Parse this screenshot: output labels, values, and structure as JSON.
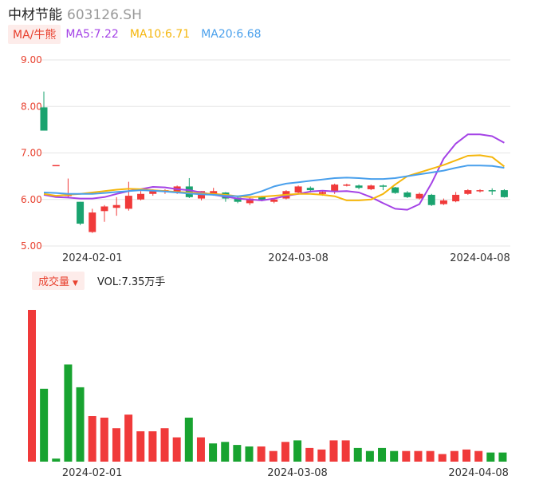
{
  "header": {
    "name": "中材节能",
    "code": "603126.SH"
  },
  "ma_bar": {
    "toggle_label": "MA/牛熊",
    "ma5": "MA5:7.22",
    "ma10": "MA10:6.71",
    "ma20": "MA20:6.68"
  },
  "volume_bar": {
    "toggle_label": "成交量",
    "vol_text": "VOL:7.35万手"
  },
  "colors": {
    "up": "#f03a3a",
    "down": "#1aa36f",
    "vol_down": "#18a330",
    "ma5": "#a442e6",
    "ma10": "#f5b60c",
    "ma20": "#4aa0ec",
    "grid": "#e6e6e6",
    "axis_text": "#e8412f"
  },
  "chart_data": [
    {
      "type": "candlestick",
      "title": "",
      "y_ticks": [
        "9.00",
        "8.00",
        "7.00",
        "6.00",
        "5.00"
      ],
      "ylim": [
        5.0,
        9.0
      ],
      "x_tick_labels": [
        "2024-02-01",
        "2024-03-08",
        "2024-04-08"
      ],
      "x_tick_indices": [
        4,
        21,
        36
      ],
      "grid": true,
      "candles": [
        {
          "o": 7.98,
          "c": 7.48,
          "h": 8.32,
          "l": 7.75
        },
        {
          "o": 6.74,
          "c": 6.74,
          "h": 6.74,
          "l": 6.74
        },
        {
          "o": 6.1,
          "c": 6.1,
          "h": 6.45,
          "l": 6.05
        },
        {
          "o": 5.95,
          "c": 5.48,
          "h": 5.95,
          "l": 5.45
        },
        {
          "o": 5.3,
          "c": 5.72,
          "h": 5.8,
          "l": 5.28
        },
        {
          "o": 5.75,
          "c": 5.85,
          "h": 5.88,
          "l": 5.52
        },
        {
          "o": 5.82,
          "c": 5.88,
          "h": 6.05,
          "l": 5.65
        },
        {
          "o": 5.8,
          "c": 6.08,
          "h": 6.38,
          "l": 5.76
        },
        {
          "o": 6.0,
          "c": 6.12,
          "h": 6.18,
          "l": 5.98
        },
        {
          "o": 6.12,
          "c": 6.18,
          "h": 6.22,
          "l": 6.08
        },
        {
          "o": 6.18,
          "c": 6.2,
          "h": 6.22,
          "l": 6.12
        },
        {
          "o": 6.15,
          "c": 6.28,
          "h": 6.3,
          "l": 6.12
        },
        {
          "o": 6.28,
          "c": 6.05,
          "h": 6.46,
          "l": 6.03
        },
        {
          "o": 6.02,
          "c": 6.18,
          "h": 6.18,
          "l": 5.98
        },
        {
          "o": 6.12,
          "c": 6.18,
          "h": 6.25,
          "l": 6.08
        },
        {
          "o": 6.15,
          "c": 6.02,
          "h": 6.16,
          "l": 5.95
        },
        {
          "o": 6.04,
          "c": 5.95,
          "h": 6.06,
          "l": 5.92
        },
        {
          "o": 5.92,
          "c": 6.02,
          "h": 6.05,
          "l": 5.88
        },
        {
          "o": 6.05,
          "c": 5.98,
          "h": 6.08,
          "l": 5.96
        },
        {
          "o": 5.95,
          "c": 6.0,
          "h": 6.02,
          "l": 5.92
        },
        {
          "o": 6.02,
          "c": 6.18,
          "h": 6.2,
          "l": 6.0
        },
        {
          "o": 6.15,
          "c": 6.28,
          "h": 6.3,
          "l": 6.12
        },
        {
          "o": 6.25,
          "c": 6.2,
          "h": 6.28,
          "l": 6.15
        },
        {
          "o": 6.12,
          "c": 6.16,
          "h": 6.2,
          "l": 6.08
        },
        {
          "o": 6.16,
          "c": 6.32,
          "h": 6.34,
          "l": 6.12
        },
        {
          "o": 6.3,
          "c": 6.32,
          "h": 6.34,
          "l": 6.28
        },
        {
          "o": 6.3,
          "c": 6.25,
          "h": 6.32,
          "l": 6.22
        },
        {
          "o": 6.22,
          "c": 6.3,
          "h": 6.32,
          "l": 6.2
        },
        {
          "o": 6.3,
          "c": 6.28,
          "h": 6.32,
          "l": 6.2
        },
        {
          "o": 6.26,
          "c": 6.14,
          "h": 6.27,
          "l": 6.12
        },
        {
          "o": 6.15,
          "c": 6.05,
          "h": 6.18,
          "l": 6.03
        },
        {
          "o": 6.02,
          "c": 6.12,
          "h": 6.15,
          "l": 6.0
        },
        {
          "o": 6.1,
          "c": 5.88,
          "h": 6.12,
          "l": 5.86
        },
        {
          "o": 5.9,
          "c": 5.98,
          "h": 6.02,
          "l": 5.88
        },
        {
          "o": 5.96,
          "c": 6.1,
          "h": 6.16,
          "l": 5.94
        },
        {
          "o": 6.12,
          "c": 6.2,
          "h": 6.22,
          "l": 6.1
        },
        {
          "o": 6.18,
          "c": 6.2,
          "h": 6.22,
          "l": 6.15
        },
        {
          "o": 6.2,
          "c": 6.19,
          "h": 6.24,
          "l": 6.1
        },
        {
          "o": 6.2,
          "c": 6.05,
          "h": 6.22,
          "l": 6.04
        }
      ],
      "series": [
        {
          "name": "MA5",
          "color_key": "ma5",
          "values": [
            6.1,
            6.05,
            6.04,
            6.02,
            6.02,
            6.05,
            6.12,
            6.18,
            6.22,
            6.27,
            6.26,
            6.22,
            6.2,
            6.15,
            6.1,
            6.06,
            6.02,
            6.0,
            5.98,
            6.02,
            6.08,
            6.12,
            6.17,
            6.19,
            6.17,
            6.18,
            6.15,
            6.05,
            5.92,
            5.8,
            5.78,
            5.9,
            6.35,
            6.88,
            7.2,
            7.4,
            7.4,
            7.36,
            7.22
          ]
        },
        {
          "name": "MA10",
          "color_key": "ma10",
          "values": [
            6.12,
            6.08,
            6.1,
            6.12,
            6.15,
            6.18,
            6.21,
            6.23,
            6.22,
            6.2,
            6.18,
            6.16,
            6.15,
            6.13,
            6.12,
            6.1,
            6.07,
            6.05,
            6.06,
            6.08,
            6.1,
            6.12,
            6.12,
            6.1,
            6.07,
            5.98,
            5.98,
            6.0,
            6.12,
            6.32,
            6.5,
            6.58,
            6.66,
            6.74,
            6.84,
            6.94,
            6.95,
            6.91,
            6.71
          ]
        },
        {
          "name": "MA20",
          "color_key": "ma20",
          "values": [
            6.15,
            6.14,
            6.12,
            6.12,
            6.12,
            6.14,
            6.16,
            6.18,
            6.2,
            6.19,
            6.17,
            6.15,
            6.13,
            6.11,
            6.1,
            6.08,
            6.07,
            6.1,
            6.18,
            6.28,
            6.34,
            6.37,
            6.4,
            6.43,
            6.46,
            6.47,
            6.46,
            6.44,
            6.44,
            6.46,
            6.5,
            6.54,
            6.58,
            6.62,
            6.68,
            6.73,
            6.73,
            6.72,
            6.68
          ]
        }
      ]
    },
    {
      "type": "bar",
      "title": "",
      "volumes": [
        1.0,
        0.48,
        0.02,
        0.64,
        0.49,
        0.3,
        0.29,
        0.22,
        0.31,
        0.2,
        0.2,
        0.22,
        0.16,
        0.29,
        0.16,
        0.12,
        0.13,
        0.11,
        0.1,
        0.1,
        0.07,
        0.13,
        0.14,
        0.09,
        0.08,
        0.14,
        0.14,
        0.09,
        0.07,
        0.09,
        0.07,
        0.07,
        0.07,
        0.07,
        0.05,
        0.07,
        0.08,
        0.07,
        0.06,
        0.06
      ],
      "directions": [
        "up",
        "down",
        "down",
        "down",
        "down",
        "up",
        "up",
        "up",
        "up",
        "up",
        "up",
        "up",
        "up",
        "down",
        "up",
        "down",
        "down",
        "down",
        "down",
        "up",
        "up",
        "up",
        "down",
        "up",
        "up",
        "up",
        "up",
        "down",
        "down",
        "down",
        "down",
        "up",
        "up",
        "up",
        "up",
        "up",
        "up",
        "up",
        "down",
        "down"
      ],
      "x_tick_labels": [
        "2024-02-01",
        "2024-03-08",
        "2024-04-08"
      ],
      "x_tick_indices": [
        5,
        22,
        37
      ]
    }
  ]
}
